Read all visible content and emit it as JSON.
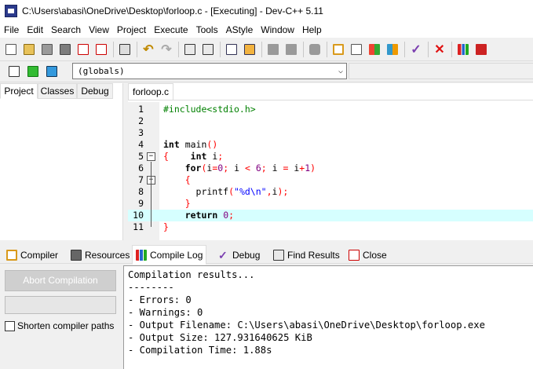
{
  "window": {
    "title": "C:\\Users\\abasi\\OneDrive\\Desktop\\forloop.c - [Executing] - Dev-C++ 5.11"
  },
  "menu": [
    "File",
    "Edit",
    "Search",
    "View",
    "Project",
    "Execute",
    "Tools",
    "AStyle",
    "Window",
    "Help"
  ],
  "toolbar2": {
    "scope_combo": "(globals)"
  },
  "left_panel": {
    "tabs": [
      "Project",
      "Classes",
      "Debug"
    ],
    "active_tab": "Project"
  },
  "editor": {
    "file_tab": "forloop.c",
    "highlighted_line": 10,
    "lines": [
      {
        "n": "1",
        "text": "#include<stdio.h>"
      },
      {
        "n": "2",
        "text": ""
      },
      {
        "n": "3",
        "text": ""
      },
      {
        "n": "4",
        "text": "int main()"
      },
      {
        "n": "5",
        "text": "{    int i;"
      },
      {
        "n": "6",
        "text": "    for(i=0; i < 6; i = i+1)"
      },
      {
        "n": "7",
        "text": "    {"
      },
      {
        "n": "8",
        "text": "      printf(\"%d\\n\",i);"
      },
      {
        "n": "9",
        "text": "    }"
      },
      {
        "n": "10",
        "text": "    return 0;"
      },
      {
        "n": "11",
        "text": "}"
      }
    ]
  },
  "bottom_tabs": [
    {
      "label": "Compiler",
      "icon": "compiler-grid-icon"
    },
    {
      "label": "Resources",
      "icon": "resources-icon"
    },
    {
      "label": "Compile Log",
      "icon": "bar-chart-icon"
    },
    {
      "label": "Debug",
      "icon": "check-icon"
    },
    {
      "label": "Find Results",
      "icon": "find-results-icon"
    },
    {
      "label": "Close",
      "icon": "close-icon"
    }
  ],
  "compile_panel": {
    "abort_label": "Abort Compilation",
    "shorten_label": "Shorten compiler paths",
    "shorten_checked": false
  },
  "compile_log": [
    "Compilation results...",
    "--------",
    "- Errors: 0",
    "- Warnings: 0",
    "- Output Filename: C:\\Users\\abasi\\OneDrive\\Desktop\\forloop.exe",
    "- Output Size: 127.931640625 KiB",
    "- Compilation Time: 1.88s"
  ],
  "colors": {
    "highlight_line": "#d6ffff",
    "keyword_red": "#ff0000",
    "preprocessor_green": "#008000",
    "number_purple": "#800080",
    "string_blue": "#0000ff"
  }
}
